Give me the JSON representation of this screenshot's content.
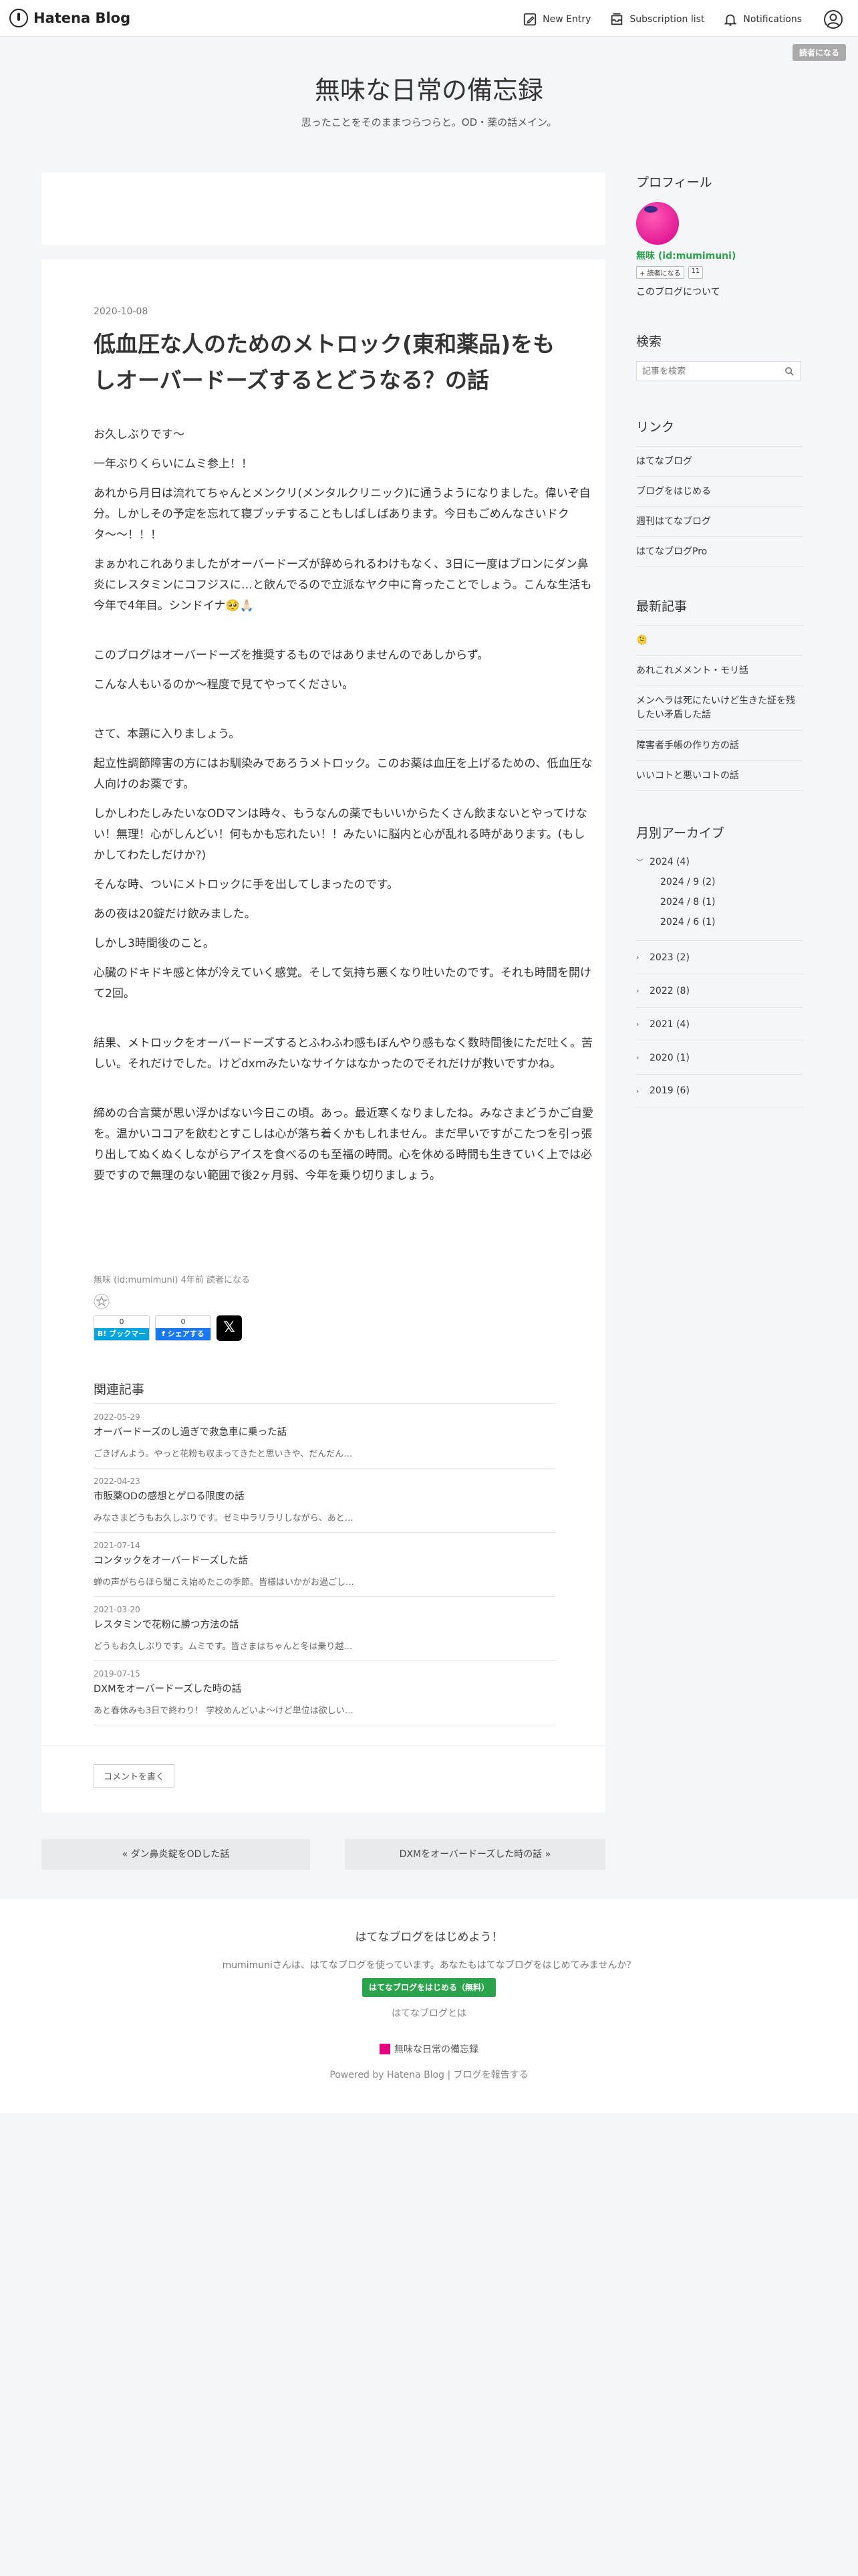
{
  "topbar": {
    "logo_text": "Hatena Blog",
    "new_entry": "New Entry",
    "subscription_list": "Subscription list",
    "notifications": "Notifications",
    "reader_button": "読者になる"
  },
  "blog": {
    "title": "無味な日常の備忘録",
    "description": "思ったことをそのままつらつらと。OD・薬の話メイン。"
  },
  "article": {
    "date": "2020-10-08",
    "title": "低血圧な人のためのメトロック(東和薬品)をもしオーバードーズするとどうなる？の話",
    "paragraphs": [
      "お久しぶりです〜",
      "一年ぶりくらいにムミ参上！！",
      "あれから月日は流れてちゃんとメンクリ(メンタルクリニック)に通うようになりました。偉いぞ自分。しかしその予定を忘れて寝ブッチすることもしばしばあります。今日もごめんなさいドクタ〜〜！！！",
      "まぁかれこれありましたがオーバードーズが辞められるわけもなく、3日に一度はブロンにダン鼻炎にレスタミンにコフジスに…と飲んでるので立派なヤク中に育ったことでしょう。こんな生活も今年で4年目。シンドイナ🥺🙏🏻",
      "",
      "このブログはオーバードーズを推奨するものではありませんのであしからず。",
      "こんな人もいるのか〜程度で見てやってください。",
      "",
      "さて、本題に入りましょう。",
      "起立性調節障害の方にはお馴染みであろうメトロック。このお薬は血圧を上げるための、低血圧な人向けのお薬です。",
      "しかしわたしみたいなODマンは時々、もうなんの薬でもいいからたくさん飲まないとやってけない！無理！心がしんどい！何もかも忘れたい！！みたいに脳内と心が乱れる時があります。(もしかしてわたしだけか?)",
      "そんな時、ついにメトロックに手を出してしまったのです。",
      "あの夜は20錠だけ飲みました。",
      "しかし3時間後のこと。",
      "心臓のドキドキ感と体が冷えていく感覚。そして気持ち悪くなり吐いたのです。それも時間を開けて2回。",
      "",
      "結果、メトロックをオーバードーズするとふわふわ感もぼんやり感もなく数時間後にただ吐く。苦しい。それだけでした。けどdxmみたいなサイケはなかったのでそれだけが救いですかね。",
      "",
      "締めの合言葉が思い浮かばない今日この頃。あっ。最近寒くなりましたね。みなさまどうかご自愛を。温かいココアを飲むとすこしは心が落ち着くかもしれません。まだ早いですがこたつを引っ張り出してぬくぬくしながらアイスを食べるのも至福の時間。心を休める時間も生きていく上では必要ですので無理のない範囲で後2ヶ月弱、今年を乗り切りましょう。"
    ],
    "meta": "無味 (id:mumimuni) 4年前   読者になる",
    "hatebu": {
      "count": "0",
      "label": "B! ブックマーク"
    },
    "facebook": {
      "count": "0",
      "label": "f シェアする"
    },
    "x_label": "𝕏",
    "related_heading": "関連記事",
    "related": [
      {
        "date": "2022-05-29",
        "title": "オーバードーズのし過ぎで救急車に乗った話",
        "excerpt": "ごきげんよう。やっと花粉も収まってきたと思いきや、だんだん…"
      },
      {
        "date": "2022-04-23",
        "title": "市販薬ODの感想とゲロる限度の話",
        "excerpt": "みなさまどうもお久しぶりです。ゼミ中ラリラリしながら、あと…"
      },
      {
        "date": "2021-07-14",
        "title": "コンタックをオーバードーズした話",
        "excerpt": "蝉の声がちらほら聞こえ始めたこの季節。皆様はいかがお過ごし…"
      },
      {
        "date": "2021-03-20",
        "title": "レスタミンで花粉に勝つ方法の話",
        "excerpt": "どうもお久しぶりです。ムミです。皆さまはちゃんと冬は乗り越…"
      },
      {
        "date": "2019-07-15",
        "title": "DXMをオーバードーズした時の話",
        "excerpt": "あと春休みも3日で終わり！ 学校めんどいよ〜けど単位は欲しい…"
      }
    ],
    "comment_button": "コメントを書く"
  },
  "pager": {
    "prev": "« ダン鼻炎錠をODした話",
    "next": "DXMをオーバードーズした時の話 »"
  },
  "sidebar": {
    "profile_heading": "プロフィール",
    "profile_name": "無味 (id:mumimuni)",
    "follow_button": "+ 読者になる",
    "follower_count": "11",
    "about_link": "このブログについて",
    "search_heading": "検索",
    "search_placeholder": "記事を検索",
    "links_heading": "リンク",
    "links": [
      "はてなブログ",
      "ブログをはじめる",
      "週刊はてなブログ",
      "はてなブログPro"
    ],
    "recent_heading": "最新記事",
    "recent": [
      "🫠",
      "あれこれメメント・モリ話",
      "メンヘラは死にたいけど生きた証を残したい矛盾した話",
      "障害者手帳の作り方の話",
      "いいコトと悪いコトの話"
    ],
    "archive_heading": "月別アーカイブ",
    "archive_open_year": "2024 (4)",
    "archive_months": [
      "2024 / 9 (2)",
      "2024 / 8 (1)",
      "2024 / 6 (1)"
    ],
    "archive_years": [
      "2023 (2)",
      "2022 (8)",
      "2021 (4)",
      "2020 (1)",
      "2019 (6)"
    ]
  },
  "footer": {
    "heading": "はてなブログをはじめよう！",
    "description": "mumimuniさんは、はてなブログを使っています。あなたもはてなブログをはじめてみませんか？",
    "start_button": "はてなブログをはじめる（無料）",
    "what_is": "はてなブログとは",
    "blog_name": "無味な日常の備忘録",
    "powered": "Powered by Hatena Blog | ブログを報告する"
  },
  "colors": {
    "accent_green": "#2ba24c",
    "hatebu_blue": "#00a4de",
    "facebook_blue": "#1877f2",
    "background": "#f4f6f9"
  }
}
